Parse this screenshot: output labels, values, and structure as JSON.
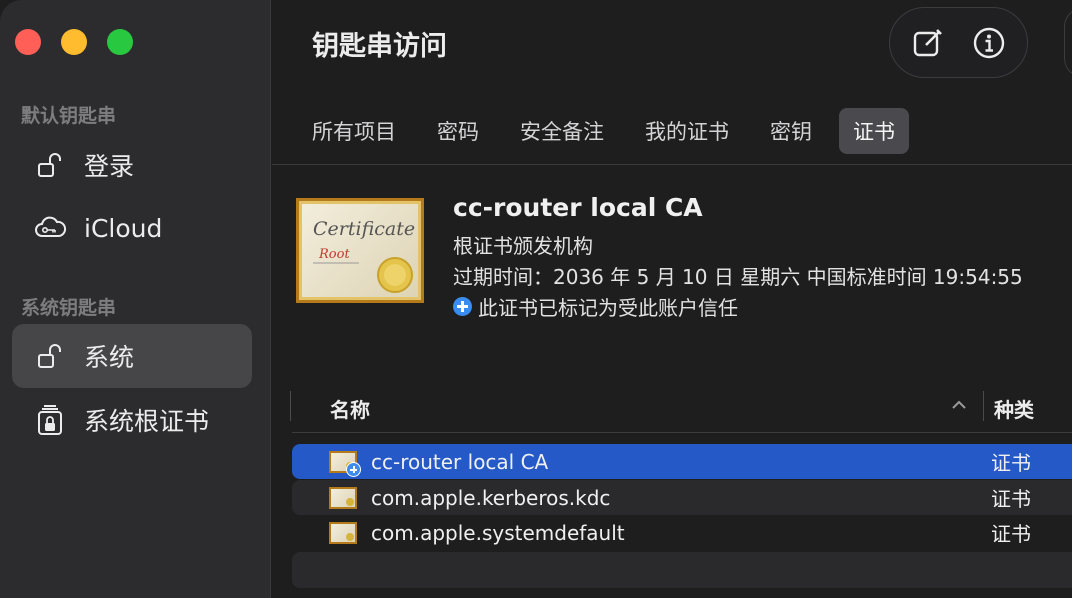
{
  "window": {
    "title": "钥匙串访问"
  },
  "sidebar": {
    "sections": [
      {
        "title": "默认钥匙串",
        "items": [
          {
            "label": "登录",
            "icon": "lock-open-icon"
          },
          {
            "label": "iCloud",
            "icon": "cloud-icon"
          }
        ]
      },
      {
        "title": "系统钥匙串",
        "items": [
          {
            "label": "系统",
            "icon": "lock-open-icon",
            "selected": true
          },
          {
            "label": "系统根证书",
            "icon": "lock-cabinet-icon"
          }
        ]
      }
    ]
  },
  "toolbar": {
    "buttons": [
      "compose-icon",
      "info-icon"
    ]
  },
  "tabs": [
    {
      "label": "所有项目"
    },
    {
      "label": "密码"
    },
    {
      "label": "安全备注"
    },
    {
      "label": "我的证书"
    },
    {
      "label": "密钥"
    },
    {
      "label": "证书",
      "active": true
    }
  ],
  "detail": {
    "icon_text_1": "Certificate",
    "icon_text_2": "Root",
    "name": "cc-router local CA",
    "kind": "根证书颁发机构",
    "expiry": "过期时间：2036 年 5 月 10 日 星期六 中国标准时间 19:54:55",
    "trust": "此证书已标记为受此账户信任"
  },
  "table": {
    "columns": {
      "name": "名称",
      "kind": "种类"
    },
    "rows": [
      {
        "name": "cc-router local CA",
        "kind": "证书",
        "selected": true,
        "trusted": true
      },
      {
        "name": "com.apple.kerberos.kdc",
        "kind": "证书"
      },
      {
        "name": "com.apple.systemdefault",
        "kind": "证书"
      }
    ]
  },
  "colors": {
    "accent": "#2459c7",
    "sidebar": "#2c2c2e",
    "background": "#1e1e1e"
  }
}
